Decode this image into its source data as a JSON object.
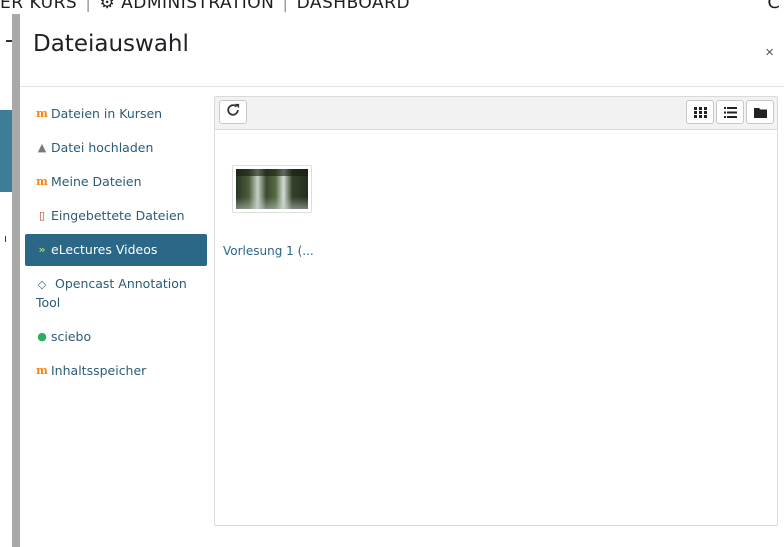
{
  "background": {
    "nav_items": [
      "ER KURS",
      "ADMINISTRATION",
      "DASHBOARD"
    ],
    "corner_glyph": "C"
  },
  "dialog": {
    "title": "Dateiauswahl",
    "close_label": "×"
  },
  "repositories": [
    {
      "label": "Dateien in Kursen",
      "icon": "moodle-icon",
      "glyph": "m"
    },
    {
      "label": "Datei hochladen",
      "icon": "upload-icon",
      "glyph": "▲"
    },
    {
      "label": "Meine Dateien",
      "icon": "moodle-icon",
      "glyph": "m"
    },
    {
      "label": "Eingebettete Dateien",
      "icon": "embedded-file-icon",
      "glyph": "▯"
    },
    {
      "label": "eLectures Videos",
      "icon": "electures-icon",
      "glyph": "»",
      "active": true
    },
    {
      "label": "Opencast Annotation Tool",
      "icon": "opencast-icon",
      "glyph": "◇"
    },
    {
      "label": "sciebo",
      "icon": "sciebo-icon",
      "glyph": "●"
    },
    {
      "label": "Inhaltsspeicher",
      "icon": "moodle-icon",
      "glyph": "m"
    }
  ],
  "toolbar": {
    "refresh_icon": "refresh-icon",
    "views": [
      "grid-view-icon",
      "list-view-icon",
      "folder-view-icon"
    ]
  },
  "files": [
    {
      "name": "Vorlesung 1 (...",
      "thumbnail": "waterfall-thumbnail"
    }
  ],
  "colors": {
    "accent": "#2b6787",
    "link": "#2b5c77",
    "moodle": "#f98012"
  }
}
